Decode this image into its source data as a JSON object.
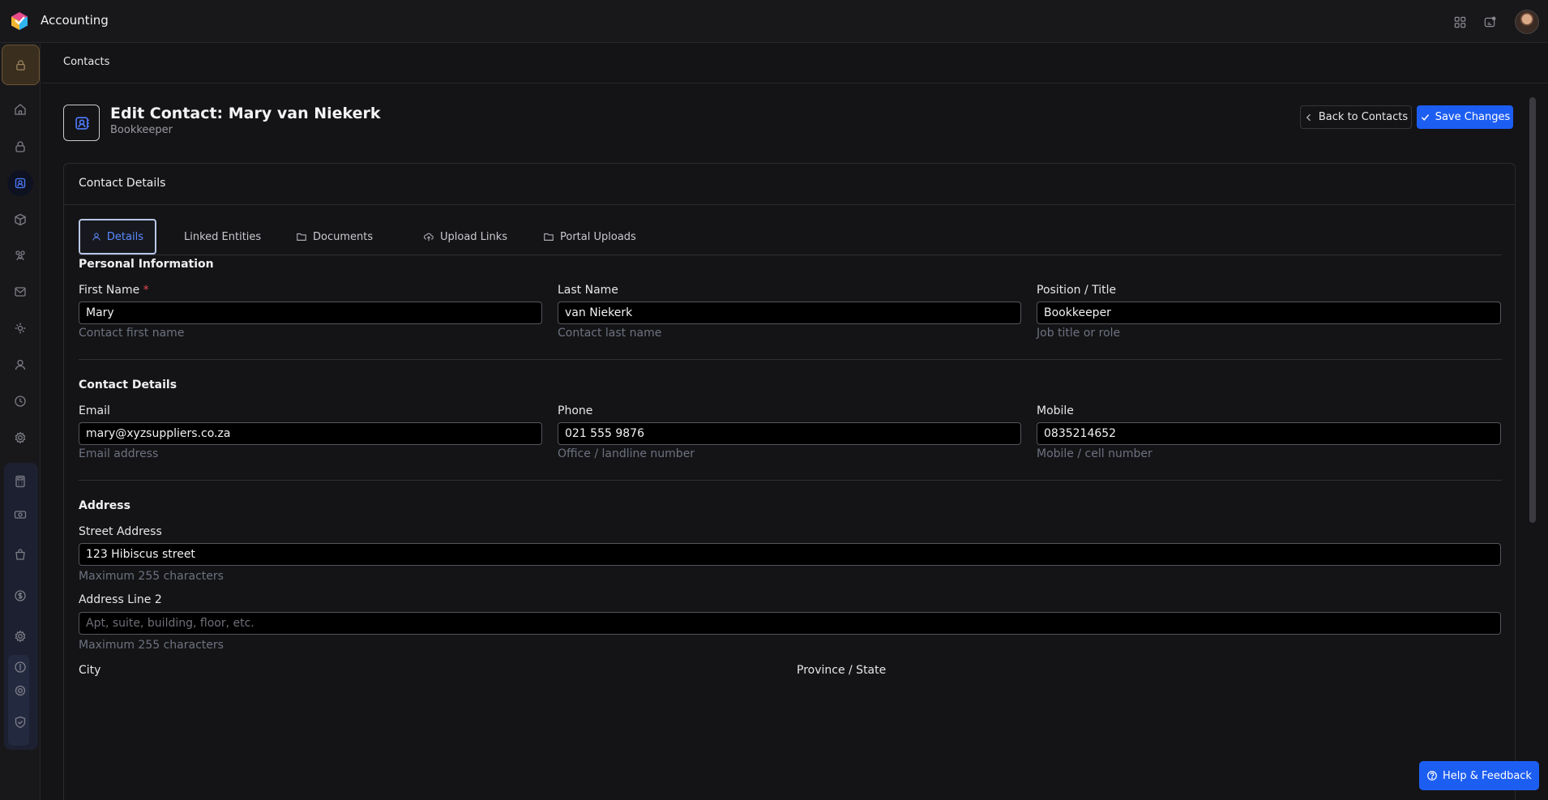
{
  "app": {
    "title": "Accounting"
  },
  "breadcrumb": {
    "current": "Contacts"
  },
  "header": {
    "title": "Edit Contact: Mary van Niekerk",
    "subtitle": "Bookkeeper",
    "back_label": "Back to Contacts",
    "save_label": "Save Changes"
  },
  "card": {
    "title": "Contact Details"
  },
  "tabs": [
    {
      "label": "Details",
      "icon": "user-icon",
      "active": true
    },
    {
      "label": "Linked Entities",
      "icon": "",
      "active": false
    },
    {
      "label": "Documents",
      "icon": "folder-icon",
      "active": false
    },
    {
      "label": "Upload Links",
      "icon": "cloud-upload-icon",
      "active": false
    },
    {
      "label": "Portal Uploads",
      "icon": "folder-icon",
      "active": false
    }
  ],
  "personal": {
    "title": "Personal Information",
    "first_name": {
      "label": "First Name",
      "required": "*",
      "value": "Mary",
      "hint": "Contact first name"
    },
    "last_name": {
      "label": "Last Name",
      "value": "van Niekerk",
      "hint": "Contact last name"
    },
    "position": {
      "label": "Position / Title",
      "value": "Bookkeeper",
      "hint": "Job title or role"
    }
  },
  "contact": {
    "title": "Contact Details",
    "email": {
      "label": "Email",
      "value": "mary@xyzsuppliers.co.za",
      "hint": "Email address"
    },
    "phone": {
      "label": "Phone",
      "value": "021 555 9876",
      "hint": "Office / landline number"
    },
    "mobile": {
      "label": "Mobile",
      "value": "0835214652",
      "hint": "Mobile / cell number"
    }
  },
  "address": {
    "title": "Address",
    "street": {
      "label": "Street Address",
      "value": "123 Hibiscus street",
      "hint": "Maximum 255 characters"
    },
    "line2": {
      "label": "Address Line 2",
      "placeholder": "Apt, suite, building, floor, etc.",
      "hint": "Maximum 255 characters"
    },
    "city": {
      "label": "City"
    },
    "province": {
      "label": "Province / State"
    }
  },
  "help": {
    "label": "Help & Feedback"
  },
  "colors": {
    "accent": "#1d5ef2",
    "background": "#141416",
    "active_tab": "#5b8aff"
  }
}
